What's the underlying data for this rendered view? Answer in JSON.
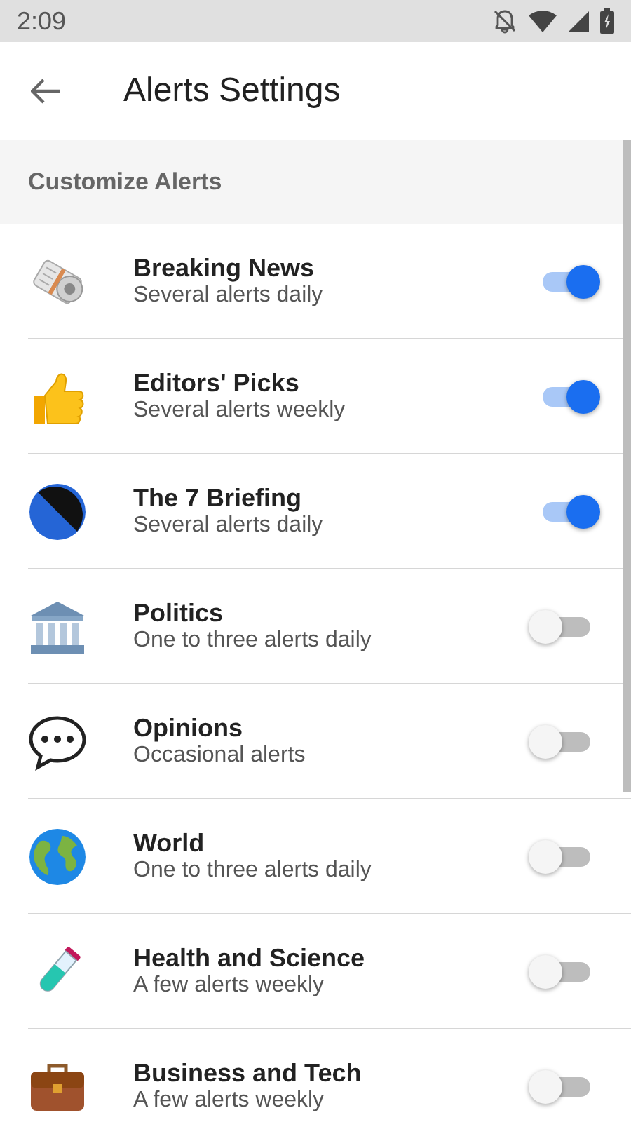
{
  "status_bar": {
    "time": "2:09"
  },
  "app_bar": {
    "title": "Alerts Settings"
  },
  "section": {
    "title": "Customize Alerts"
  },
  "alerts": [
    {
      "title": "Breaking News",
      "subtitle": "Several alerts daily",
      "on": true
    },
    {
      "title": "Editors' Picks",
      "subtitle": "Several alerts weekly",
      "on": true
    },
    {
      "title": "The 7 Briefing",
      "subtitle": "Several alerts daily",
      "on": true
    },
    {
      "title": "Politics",
      "subtitle": "One to three alerts daily",
      "on": false
    },
    {
      "title": "Opinions",
      "subtitle": "Occasional alerts",
      "on": false
    },
    {
      "title": "World",
      "subtitle": "One to three alerts daily",
      "on": false
    },
    {
      "title": "Health and Science",
      "subtitle": "A few alerts weekly",
      "on": false
    },
    {
      "title": "Business and Tech",
      "subtitle": "A few alerts weekly",
      "on": false
    }
  ]
}
